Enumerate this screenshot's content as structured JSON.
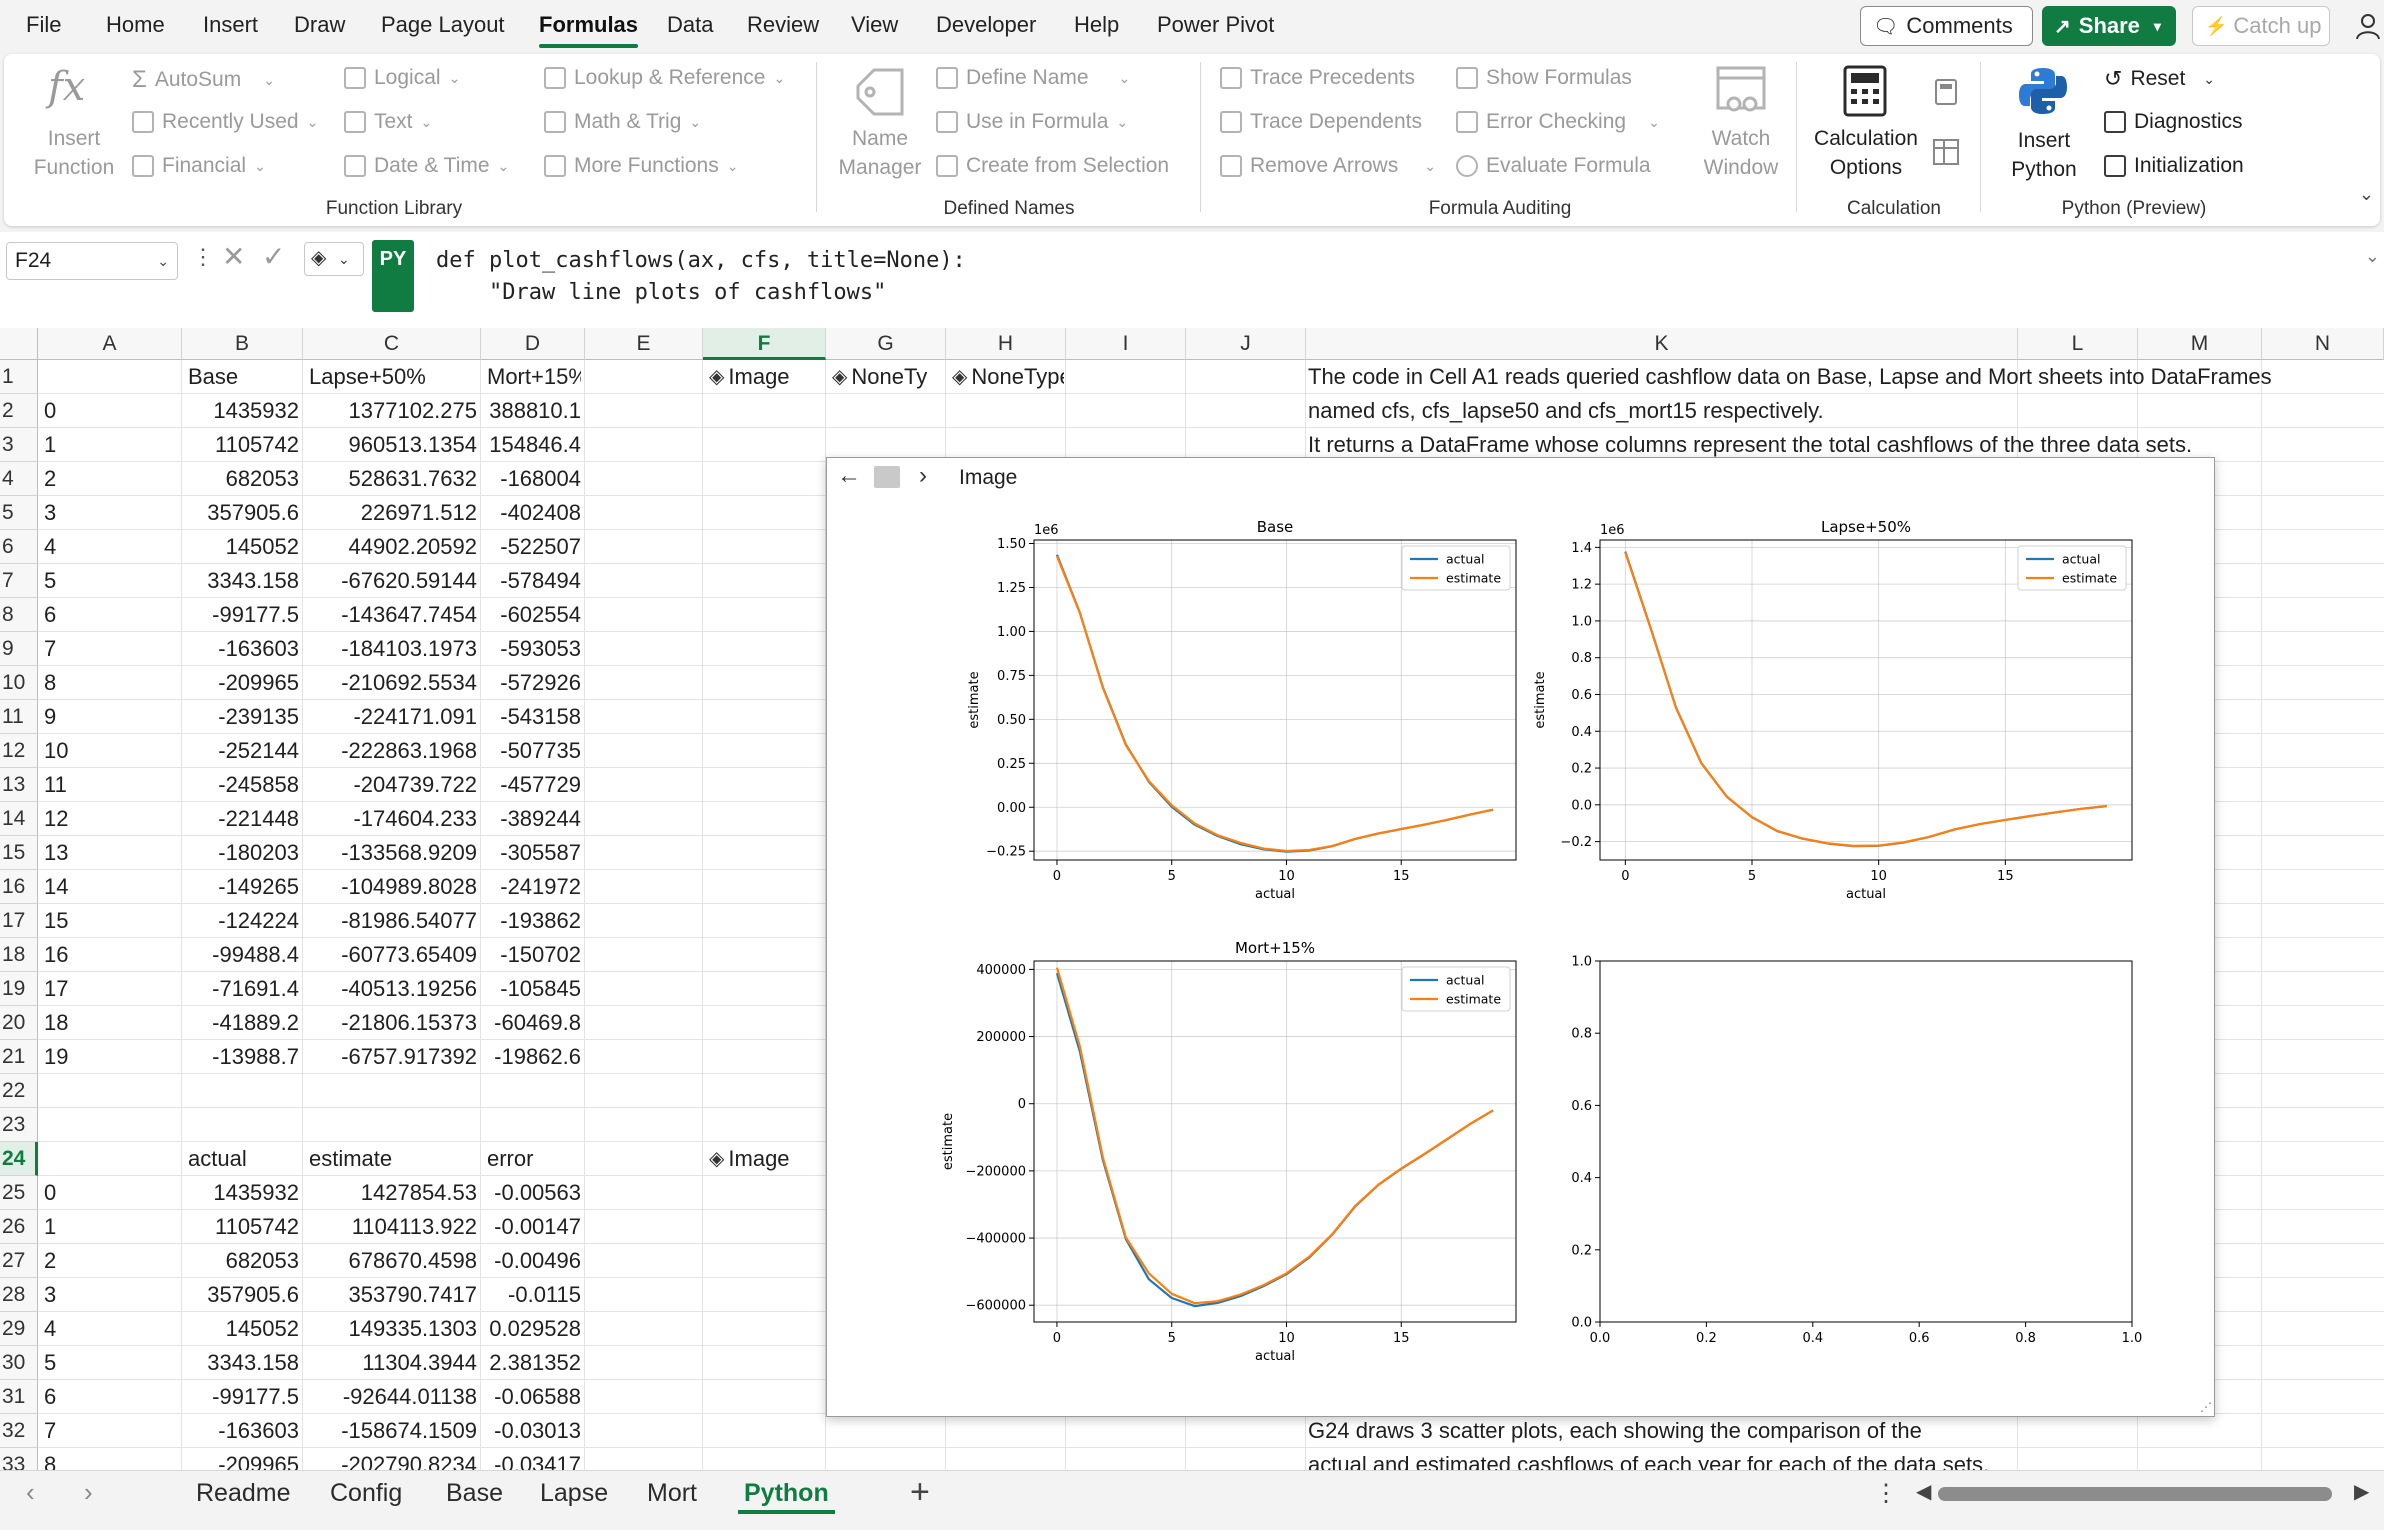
{
  "menu": {
    "tabs": [
      "File",
      "Home",
      "Insert",
      "Draw",
      "Page Layout",
      "Formulas",
      "Data",
      "Review",
      "View",
      "Developer",
      "Help",
      "Power Pivot"
    ],
    "active_tab": "Formulas",
    "comments_label": "Comments",
    "share_label": "Share",
    "catchup_label": "Catch up"
  },
  "ribbon": {
    "insert_function": "Insert Function",
    "autosum": "AutoSum",
    "recently_used": "Recently Used",
    "financial": "Financial",
    "logical": "Logical",
    "text": "Text",
    "date_time": "Date & Time",
    "lookup_reference": "Lookup & Reference",
    "math_trig": "Math & Trig",
    "more_functions": "More Functions",
    "function_library_group": "Function Library",
    "name_manager": "Name Manager",
    "define_name": "Define Name",
    "use_in_formula": "Use in Formula",
    "create_from_selection": "Create from Selection",
    "defined_names_group": "Defined Names",
    "trace_precedents": "Trace Precedents",
    "trace_dependents": "Trace Dependents",
    "remove_arrows": "Remove Arrows",
    "show_formulas": "Show Formulas",
    "error_checking": "Error Checking",
    "evaluate_formula": "Evaluate Formula",
    "watch_window": "Watch Window",
    "formula_auditing_group": "Formula Auditing",
    "calculation_options": "Calculation Options",
    "calculation_group": "Calculation",
    "insert_python": "Insert Python",
    "reset": "Reset",
    "diagnostics": "Diagnostics",
    "initialization": "Initialization",
    "python_group": "Python (Preview)"
  },
  "formula_bar": {
    "cell_ref": "F24",
    "py_badge": "PY",
    "code_line1": "def plot_cashflows(ax, cfs, title=None):",
    "code_line2": "    \"Draw line plots of cashflows\""
  },
  "columns": [
    "A",
    "B",
    "C",
    "D",
    "E",
    "F",
    "G",
    "H",
    "I",
    "J",
    "K",
    "L",
    "M",
    "N"
  ],
  "selected_column": "F",
  "selected_row": "24",
  "rows": [
    "1",
    "2",
    "3",
    "4",
    "5",
    "6",
    "7",
    "8",
    "9",
    "10",
    "11",
    "12",
    "13",
    "14",
    "15",
    "16",
    "17",
    "18",
    "19",
    "20",
    "21",
    "22",
    "23",
    "24",
    "25",
    "26",
    "27",
    "28",
    "29",
    "30",
    "31",
    "32",
    "33"
  ],
  "table1": {
    "headers": [
      "Base",
      "Lapse+50%",
      "Mort+15%"
    ],
    "index": [
      "0",
      "1",
      "2",
      "3",
      "4",
      "5",
      "6",
      "7",
      "8",
      "9",
      "10",
      "11",
      "12",
      "13",
      "14",
      "15",
      "16",
      "17",
      "18",
      "19"
    ],
    "base": [
      "1435932",
      "1105742",
      "682053",
      "357905.6",
      "145052",
      "3343.158",
      "-99177.5",
      "-163603",
      "-209965",
      "-239135",
      "-252144",
      "-245858",
      "-221448",
      "-180203",
      "-149265",
      "-124224",
      "-99488.4",
      "-71691.4",
      "-41889.2",
      "-13988.7"
    ],
    "lapse": [
      "1377102.275",
      "960513.1354",
      "528631.7632",
      "226971.512",
      "44902.20592",
      "-67620.59144",
      "-143647.7454",
      "-184103.1973",
      "-210692.5534",
      "-224171.091",
      "-222863.1968",
      "-204739.722",
      "-174604.233",
      "-133568.9209",
      "-104989.8028",
      "-81986.54077",
      "-60773.65409",
      "-40513.19256",
      "-21806.15373",
      "-6757.917392"
    ],
    "mort": [
      "388810.1",
      "154846.4",
      "-168004",
      "-402408",
      "-522507",
      "-578494",
      "-602554",
      "-593053",
      "-572926",
      "-543158",
      "-507735",
      "-457729",
      "-389244",
      "-305587",
      "-241972",
      "-193862",
      "-150702",
      "-105845",
      "-60469.8",
      "-19862.6"
    ]
  },
  "type_cells": {
    "f1": "Image",
    "g1": "NoneTy",
    "h1": "NoneType",
    "f24": "Image"
  },
  "table2": {
    "headers": [
      "actual",
      "estimate",
      "error"
    ],
    "index": [
      "0",
      "1",
      "2",
      "3",
      "4",
      "5",
      "6",
      "7",
      "8"
    ],
    "actual": [
      "1435932",
      "1105742",
      "682053",
      "357905.6",
      "145052",
      "3343.158",
      "-99177.5",
      "-163603",
      "-209965"
    ],
    "estimate": [
      "1427854.53",
      "1104113.922",
      "678670.4598",
      "353790.7417",
      "149335.1303",
      "11304.3944",
      "-92644.01138",
      "-158674.1509",
      "-202790.8234"
    ],
    "error": [
      "-0.00563",
      "-0.00147",
      "-0.00496",
      "-0.0115",
      "0.029528",
      "2.381352",
      "-0.06588",
      "-0.03013",
      "-0.03417"
    ]
  },
  "notes": {
    "k1": "The code in Cell A1 reads queried cashflow data on Base, Lapse and Mort sheets into DataFrames",
    "k2": "named cfs, cfs_lapse50 and cfs_mort15 respectively.",
    "k3": "It returns a DataFrame whose columns represent the total cashflows of the three data sets.",
    "k32": "G24 draws 3 scatter plots, each showing the comparison of the",
    "k33": "actual and estimated cashflows of each year for each of the data sets."
  },
  "image_card": {
    "title": "Image"
  },
  "sheet_tabs": [
    "Readme",
    "Config",
    "Base",
    "Lapse",
    "Mort",
    "Python"
  ],
  "active_sheet": "Python",
  "colors": {
    "excel_green": "#107c41",
    "actual": "#1f77b4",
    "estimate": "#ff7f0e"
  },
  "chart_data": [
    {
      "type": "line",
      "title": "Base",
      "xlabel": "actual",
      "ylabel": "estimate",
      "y_scale_label": "1e6",
      "xlim": [
        -1,
        20
      ],
      "ylim": [
        -0.3,
        1.52
      ],
      "xticks": [
        0,
        5,
        10,
        15
      ],
      "yticks": [
        -0.25,
        0.0,
        0.25,
        0.5,
        0.75,
        1.0,
        1.25,
        1.5
      ],
      "ytick_labels": [
        "−0.25",
        "0.00",
        "0.25",
        "0.50",
        "0.75",
        "1.00",
        "1.25",
        "1.50"
      ],
      "legend": "top-right",
      "grid": true,
      "x": [
        0,
        1,
        2,
        3,
        4,
        5,
        6,
        7,
        8,
        9,
        10,
        11,
        12,
        13,
        14,
        15,
        16,
        17,
        18,
        19
      ],
      "series": [
        {
          "name": "actual",
          "color": "#1f77b4",
          "values": [
            1.435932,
            1.105742,
            0.682053,
            0.3579056,
            0.145052,
            0.003343,
            -0.0991775,
            -0.163603,
            -0.209965,
            -0.239135,
            -0.252144,
            -0.245858,
            -0.221448,
            -0.180203,
            -0.149265,
            -0.124224,
            -0.0994884,
            -0.0716914,
            -0.0418892,
            -0.0139887
          ]
        },
        {
          "name": "estimate",
          "color": "#ff7f0e",
          "values": [
            1.42785453,
            1.10411392,
            0.67867046,
            0.35379074,
            0.14933513,
            0.01130439,
            -0.09264401,
            -0.15867415,
            -0.20279082,
            -0.2351,
            -0.2488,
            -0.2432,
            -0.2198,
            -0.1795,
            -0.1487,
            -0.1238,
            -0.0992,
            -0.0715,
            -0.0418,
            -0.014
          ]
        }
      ]
    },
    {
      "type": "line",
      "title": "Lapse+50%",
      "xlabel": "actual",
      "ylabel": "estimate",
      "y_scale_label": "1e6",
      "xlim": [
        -1,
        20
      ],
      "ylim": [
        -0.3,
        1.44
      ],
      "xticks": [
        0,
        5,
        10,
        15
      ],
      "yticks": [
        -0.2,
        0.0,
        0.2,
        0.4,
        0.6,
        0.8,
        1.0,
        1.2,
        1.4
      ],
      "ytick_labels": [
        "−0.2",
        "0.0",
        "0.2",
        "0.4",
        "0.6",
        "0.8",
        "1.0",
        "1.2",
        "1.4"
      ],
      "legend": "top-right",
      "grid": true,
      "x": [
        0,
        1,
        2,
        3,
        4,
        5,
        6,
        7,
        8,
        9,
        10,
        11,
        12,
        13,
        14,
        15,
        16,
        17,
        18,
        19
      ],
      "series": [
        {
          "name": "actual",
          "color": "#1f77b4",
          "values": [
            1.377102,
            0.960513,
            0.528632,
            0.226972,
            0.044902,
            -0.067621,
            -0.143648,
            -0.184103,
            -0.210693,
            -0.224171,
            -0.222863,
            -0.20474,
            -0.174604,
            -0.133569,
            -0.10499,
            -0.081987,
            -0.060774,
            -0.040513,
            -0.021806,
            -0.006758
          ]
        },
        {
          "name": "estimate",
          "color": "#ff7f0e",
          "values": [
            1.3731,
            0.9585,
            0.5271,
            0.2258,
            0.0452,
            -0.0668,
            -0.1425,
            -0.1832,
            -0.2096,
            -0.2231,
            -0.2219,
            -0.2039,
            -0.1739,
            -0.1331,
            -0.1046,
            -0.0817,
            -0.0606,
            -0.0404,
            -0.0218,
            -0.0068
          ]
        }
      ]
    },
    {
      "type": "line",
      "title": "Mort+15%",
      "xlabel": "actual",
      "ylabel": "estimate",
      "xlim": [
        -1,
        20
      ],
      "ylim": [
        -650000,
        425000
      ],
      "xticks": [
        0,
        5,
        10,
        15
      ],
      "yticks": [
        -600000,
        -400000,
        -200000,
        0,
        200000,
        400000
      ],
      "ytick_labels": [
        "−600000",
        "−400000",
        "−200000",
        "0",
        "200000",
        "400000"
      ],
      "legend": "top-right",
      "grid": true,
      "x": [
        0,
        1,
        2,
        3,
        4,
        5,
        6,
        7,
        8,
        9,
        10,
        11,
        12,
        13,
        14,
        15,
        16,
        17,
        18,
        19
      ],
      "series": [
        {
          "name": "actual",
          "color": "#1f77b4",
          "values": [
            388810.1,
            154846.4,
            -168004,
            -402408,
            -522507,
            -578494,
            -602554,
            -593053,
            -572926,
            -543158,
            -507735,
            -457729,
            -389244,
            -305587,
            -241972,
            -193862,
            -150702,
            -105845,
            -60469.8,
            -19862.6
          ]
        },
        {
          "name": "estimate",
          "color": "#ff7f0e",
          "values": [
            405000,
            170000,
            -160000,
            -398000,
            -505000,
            -566000,
            -594000,
            -588000,
            -568000,
            -540000,
            -505000,
            -455000,
            -388000,
            -304000,
            -241000,
            -193000,
            -150000,
            -105500,
            -60200,
            -19700
          ]
        }
      ]
    },
    {
      "type": "line",
      "title": "",
      "xlim": [
        0,
        1
      ],
      "ylim": [
        0,
        1
      ],
      "xticks": [
        0.0,
        0.2,
        0.4,
        0.6,
        0.8,
        1.0
      ],
      "xtick_labels": [
        "0.0",
        "0.2",
        "0.4",
        "0.6",
        "0.8",
        "1.0"
      ],
      "yticks": [
        0.0,
        0.2,
        0.4,
        0.6,
        0.8,
        1.0
      ],
      "ytick_labels": [
        "0.0",
        "0.2",
        "0.4",
        "0.6",
        "0.8",
        "1.0"
      ],
      "grid": false,
      "series": []
    }
  ]
}
